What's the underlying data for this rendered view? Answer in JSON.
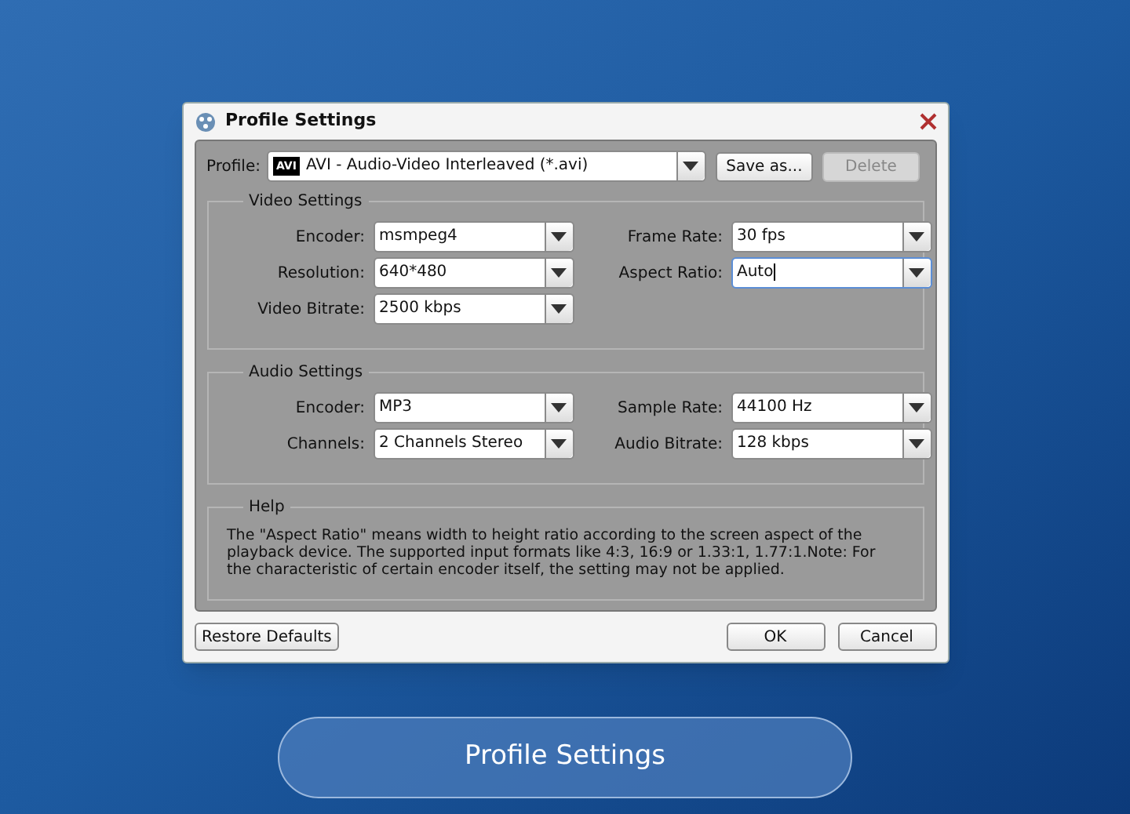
{
  "window": {
    "title": "Profile Settings"
  },
  "profile": {
    "label": "Profile:",
    "value": "AVI - Audio-Video Interleaved (*.avi)",
    "format_badge": "AVI"
  },
  "profile_buttons": [
    {
      "label": "Save as...",
      "disabled": false
    },
    {
      "label": "Delete",
      "disabled": true
    }
  ],
  "video_settings": {
    "title": "Video Settings",
    "fields": [
      {
        "label": "Encoder:",
        "value": "msmpeg4",
        "focused": false
      },
      {
        "label": "Frame Rate:",
        "value": "30 fps",
        "focused": false
      },
      {
        "label": "Resolution:",
        "value": "640*480",
        "focused": false
      },
      {
        "label": "Aspect Ratio:",
        "value": "Auto",
        "focused": true
      },
      {
        "label": "Video Bitrate:",
        "value": "2500 kbps",
        "focused": false
      }
    ]
  },
  "audio_settings": {
    "title": "Audio Settings",
    "fields": [
      {
        "label": "Encoder:",
        "value": "MP3",
        "focused": false
      },
      {
        "label": "Sample Rate:",
        "value": "44100 Hz",
        "focused": false
      },
      {
        "label": "Channels:",
        "value": "2 Channels Stereo",
        "focused": false
      },
      {
        "label": "Audio Bitrate:",
        "value": "128 kbps",
        "focused": false
      }
    ]
  },
  "help": {
    "title": "Help",
    "text": "The \"Aspect Ratio\" means width to height ratio according to the screen aspect of the playback device. The supported input formats like 4:3, 16:9 or 1.33:1, 1.77:1.Note: For the characteristic of certain encoder itself, the setting may not be applied."
  },
  "footer_buttons": [
    {
      "label": "Restore Defaults"
    },
    {
      "label": "OK"
    },
    {
      "label": "Cancel"
    }
  ],
  "caption": "Profile Settings"
}
